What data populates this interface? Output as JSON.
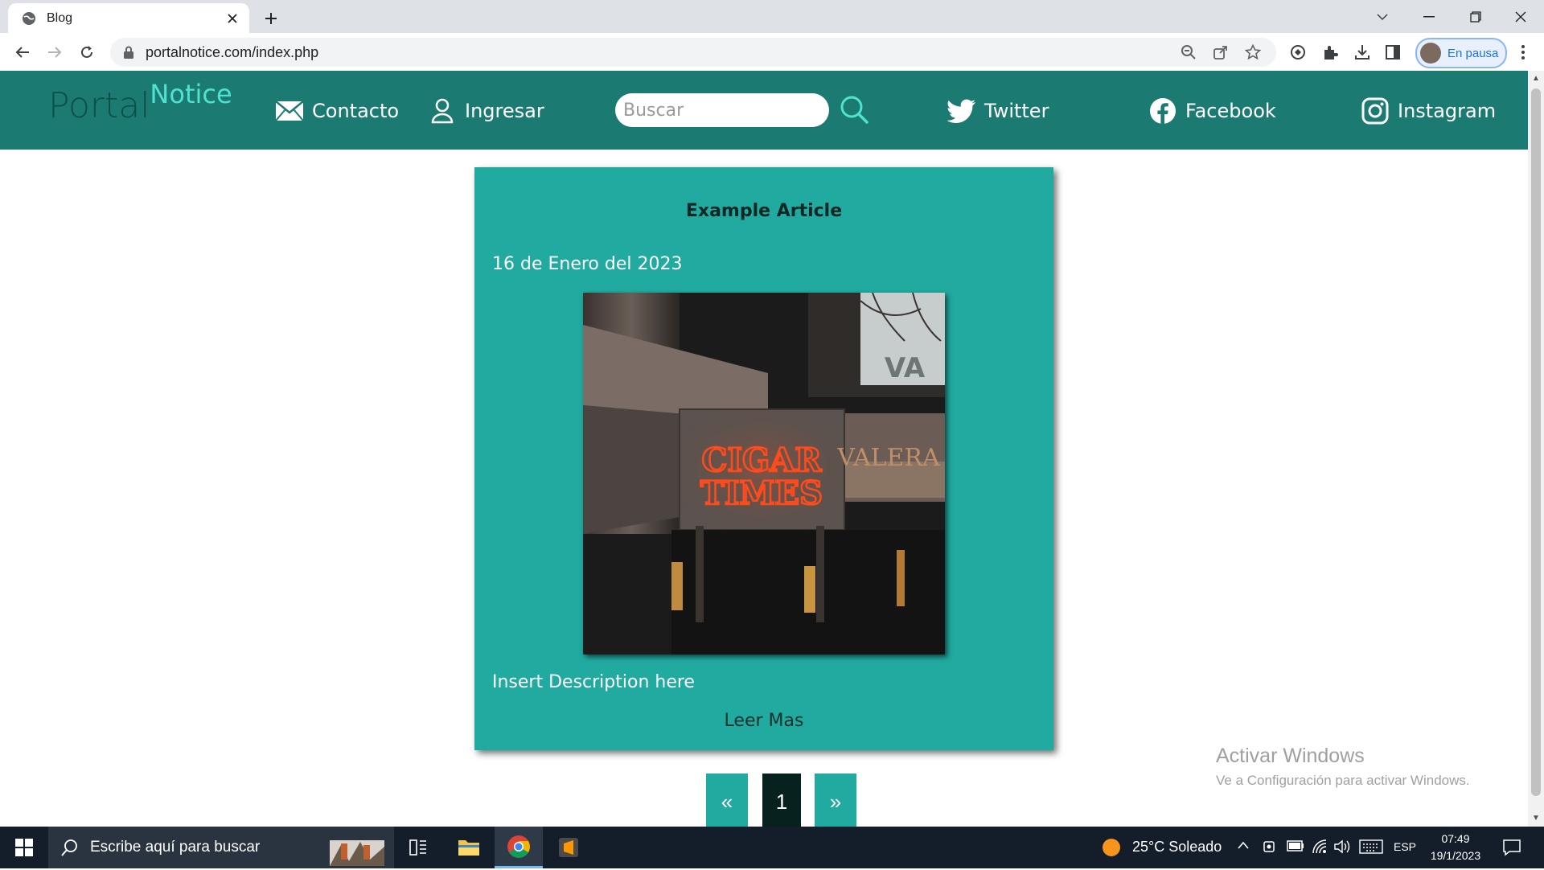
{
  "browser": {
    "tab_title": "Blog",
    "url": "portalnotice.com/index.php",
    "profile_label": "En pausa"
  },
  "site": {
    "logo_part1": "Portal",
    "logo_part2": "Notice",
    "nav": {
      "contact": "Contacto",
      "login": "Ingresar",
      "twitter": "Twitter",
      "facebook": "Facebook",
      "instagram": "Instagram"
    },
    "search_placeholder": "Buscar"
  },
  "article": {
    "title": "Example Article",
    "date": "16 de Enero del 2023",
    "image_sign_line1": "CIGAR",
    "image_sign_line2": "TIMES",
    "image_sign_back": "VA",
    "image_sign_side": "VALERA",
    "description": "Insert Description here",
    "read_more": "Leer Mas"
  },
  "pagination": {
    "prev": "«",
    "current": "1",
    "next": "»"
  },
  "watermark": {
    "title": "Activar Windows",
    "subtitle": "Ve a Configuración para activar Windows."
  },
  "taskbar": {
    "search_placeholder": "Escribe aquí para buscar",
    "weather": "25°C  Soleado",
    "language": "ESP",
    "time": "07:49",
    "date": "19/1/2023"
  },
  "colors": {
    "nav_bg": "#1b7b72",
    "card_bg": "#21aaa0",
    "accent": "#4fe3cf"
  }
}
